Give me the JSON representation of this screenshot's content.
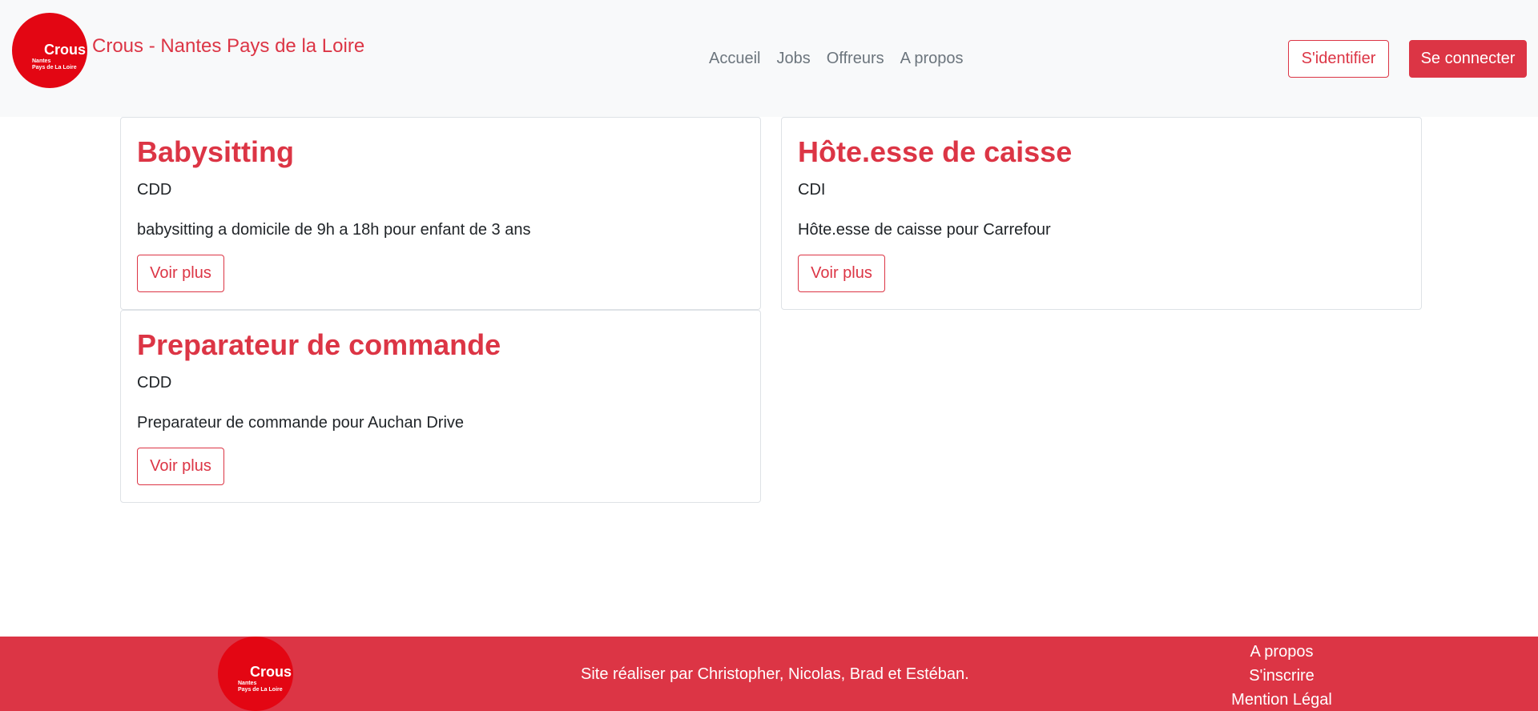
{
  "header": {
    "logo": {
      "word": "Crous",
      "line1": "Nantes",
      "line2": "Pays de La Loire"
    },
    "brand": "Crous - Nantes Pays de la Loire",
    "nav": [
      "Accueil",
      "Jobs",
      "Offreurs",
      "A propos"
    ],
    "login_label": "S'identifier",
    "signup_label": "Se connecter"
  },
  "jobs": [
    {
      "title": "Babysitting",
      "type": "CDD",
      "description": "babysitting a domicile de 9h a 18h pour enfant de 3 ans",
      "button": "Voir plus"
    },
    {
      "title": "Hôte.esse de caisse",
      "type": "CDI",
      "description": "Hôte.esse de caisse pour Carrefour",
      "button": "Voir plus"
    },
    {
      "title": "Preparateur de commande",
      "type": "CDD",
      "description": "Preparateur de commande pour Auchan Drive",
      "button": "Voir plus"
    }
  ],
  "footer": {
    "logo": {
      "word": "Crous",
      "line1": "Nantes",
      "line2": "Pays de La Loire"
    },
    "credit": "Site réaliser par Christopher, Nicolas, Brad et Estéban.",
    "links": [
      "A propos",
      "S'inscrire",
      "Mention Légal"
    ]
  },
  "colors": {
    "accent": "#dc3545",
    "logo_red": "#e30613",
    "navbar_bg": "#f8f9fa"
  }
}
